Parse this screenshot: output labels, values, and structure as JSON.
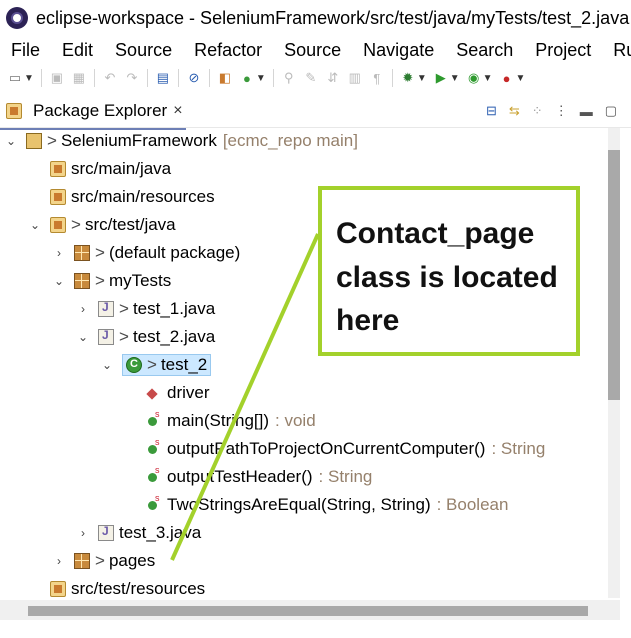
{
  "window": {
    "title": "eclipse-workspace - SeleniumFramework/src/test/java/myTests/test_2.java"
  },
  "menu": [
    "File",
    "Edit",
    "Source",
    "Refactor",
    "Source",
    "Navigate",
    "Search",
    "Project",
    "Run"
  ],
  "toolbar": {
    "icons": [
      "new-icon",
      "save-icon",
      "save-all-icon",
      "undo-icon",
      "redo-icon",
      "console-icon",
      "breakpoint-icon",
      "open-type-icon",
      "new-class-icon",
      "pin-icon",
      "annotation-icon",
      "next-annotation-icon",
      "toggle-mark-icon",
      "show-whitespace-icon",
      "debug-icon",
      "run-icon",
      "coverage-icon",
      "external-tools-icon"
    ]
  },
  "view": {
    "tab_label": "Package Explorer",
    "close_glyph": "×",
    "actions": [
      "collapse-all-icon",
      "link-with-editor-icon",
      "filters-icon",
      "view-menu-icon",
      "minimize-icon",
      "maximize-icon"
    ]
  },
  "tree": {
    "items": [
      {
        "twisty": "⌄",
        "icon": "project-icon",
        "deco": ">",
        "label": "SeleniumFramework",
        "extra": "[ecmc_repo main]"
      },
      {
        "twisty": "",
        "icon": "source-folder-icon",
        "deco": "",
        "label": "src/main/java",
        "extra": ""
      },
      {
        "twisty": "",
        "icon": "source-folder-icon",
        "deco": "",
        "label": "src/main/resources",
        "extra": ""
      },
      {
        "twisty": "⌄",
        "icon": "source-folder-icon",
        "deco": ">",
        "label": "src/test/java",
        "extra": ""
      },
      {
        "twisty": "›",
        "icon": "package-icon",
        "deco": ">",
        "label": "(default package)",
        "extra": ""
      },
      {
        "twisty": "⌄",
        "icon": "package-icon",
        "deco": ">",
        "label": "myTests",
        "extra": ""
      },
      {
        "twisty": "›",
        "icon": "java-file-icon",
        "deco": ">",
        "label": "test_1.java",
        "extra": ""
      },
      {
        "twisty": "⌄",
        "icon": "java-file-icon",
        "deco": ">",
        "label": "test_2.java",
        "extra": ""
      },
      {
        "twisty": "⌄",
        "icon": "class-icon",
        "deco": ">",
        "label": "test_2",
        "extra": ""
      },
      {
        "twisty": "",
        "icon": "field-icon",
        "deco": "",
        "label": "driver",
        "extra": ""
      },
      {
        "twisty": "",
        "icon": "method-icon",
        "deco": "",
        "label": "main(String[])",
        "extra": ": void"
      },
      {
        "twisty": "",
        "icon": "method-icon",
        "deco": "",
        "label": "outputPathToProjectOnCurrentComputer()",
        "extra": ": String"
      },
      {
        "twisty": "",
        "icon": "method-icon",
        "deco": "",
        "label": "outputTestHeader()",
        "extra": ": String"
      },
      {
        "twisty": "",
        "icon": "method-icon",
        "deco": "",
        "label": "TwoStringsAreEqual(String, String)",
        "extra": ": Boolean"
      },
      {
        "twisty": "›",
        "icon": "java-file-icon",
        "deco": "",
        "label": "test_3.java",
        "extra": ""
      },
      {
        "twisty": "›",
        "icon": "package-icon",
        "deco": ">",
        "label": "pages",
        "extra": ""
      },
      {
        "twisty": "",
        "icon": "source-folder-icon",
        "deco": "",
        "label": "src/test/resources",
        "extra": ""
      }
    ]
  },
  "callout": {
    "text_line1": "Contact_page",
    "text_line2": "class is located",
    "text_line3": "here",
    "border_color": "#a3d12b"
  },
  "colors": {
    "selection": "#cce8ff",
    "decoration_gray": "#95806b",
    "tab_underline": "#6d7fb5"
  }
}
